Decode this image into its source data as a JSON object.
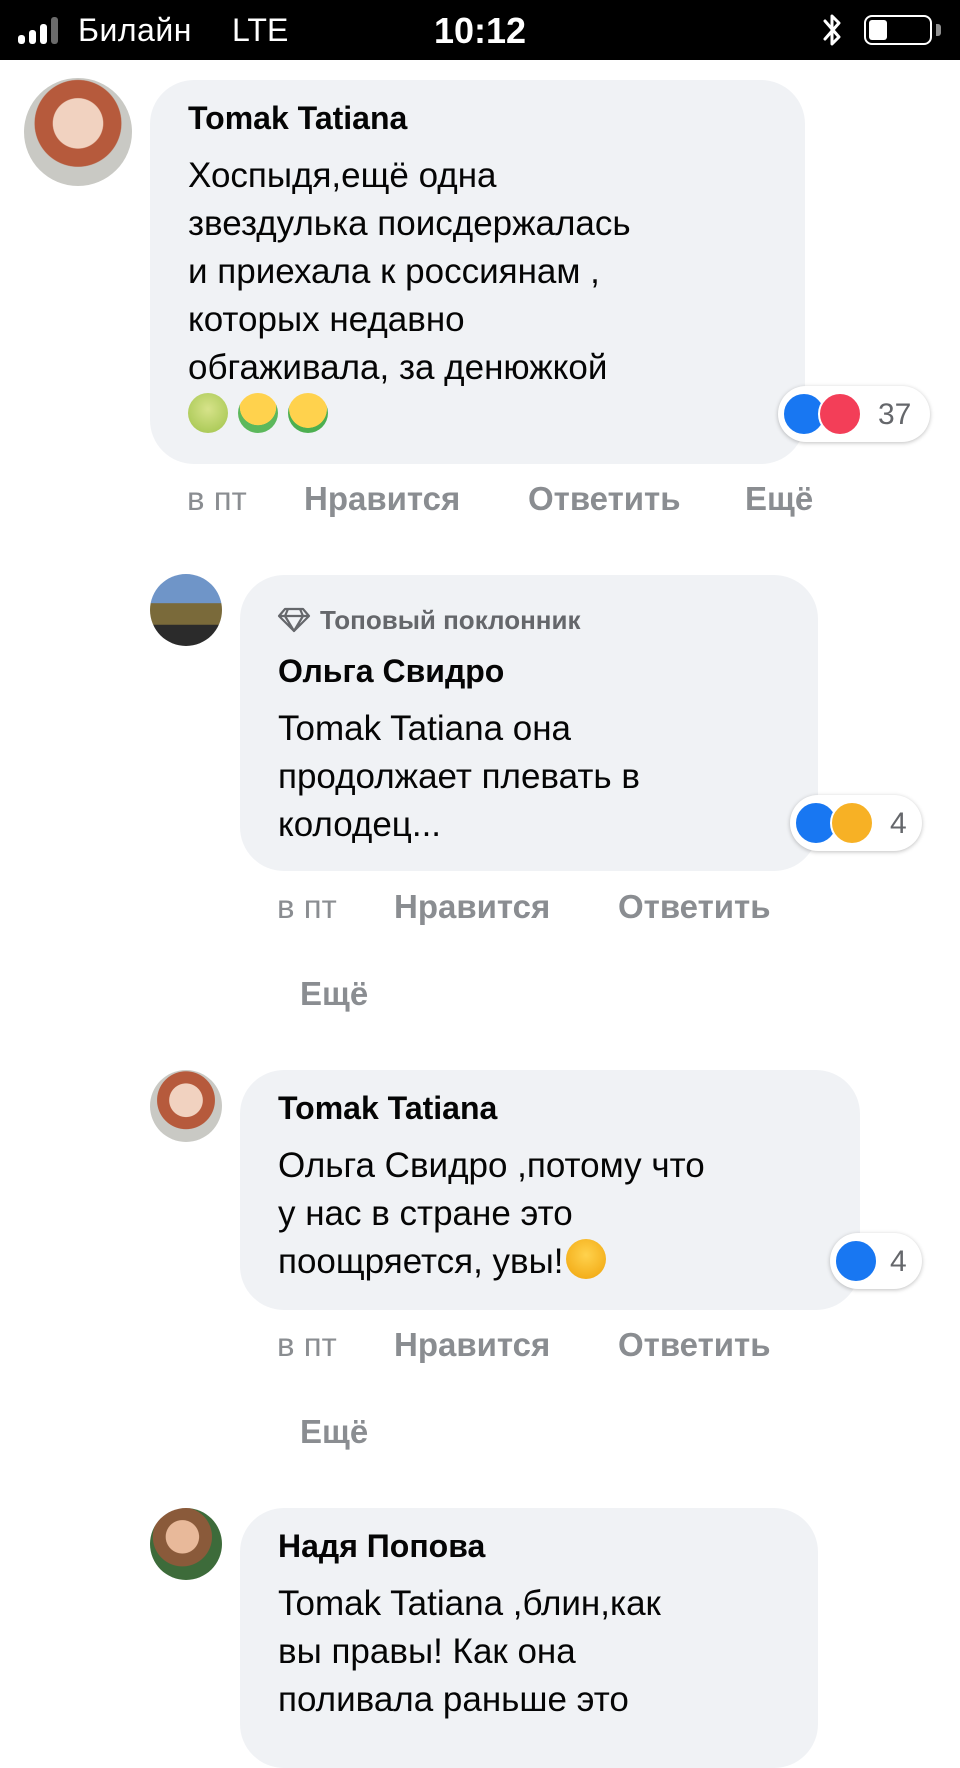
{
  "status_bar": {
    "carrier": "Билайн",
    "network": "LTE",
    "time": "10:12"
  },
  "comments": [
    {
      "author": "Tomak Tatiana",
      "lines": [
        "Хоспыдя,ещё одна",
        "звездулька поисдержалась",
        "и приехала к россиянам ,",
        "которых недавно",
        "обгаживала, за денюжкой"
      ],
      "emojis": [
        "nauseated-face-emoji",
        "vomiting-face-emoji",
        "money-mouth-face-emoji"
      ],
      "reaction_count": "37",
      "reaction_icons": [
        "like-reaction-icon",
        "love-reaction-icon"
      ],
      "time": "в пт",
      "like_label": "Нравится",
      "reply_label": "Ответить",
      "more_label": "Ещё"
    },
    {
      "badge": "Топовый поклонник",
      "author": "Ольга Свидро",
      "lines": [
        "Tomak Tatiana она",
        "продолжает плевать в",
        "колодец..."
      ],
      "reaction_count": "4",
      "reaction_icons": [
        "like-reaction-icon",
        "haha-reaction-icon"
      ],
      "time": "в пт",
      "like_label": "Нравится",
      "reply_label": "Ответить",
      "more_label": "Ещё"
    },
    {
      "author": "Tomak Tatiana",
      "lines": [
        "Ольга Свидро ,потому что",
        "у нас в стране это",
        "поощряется, увы!"
      ],
      "emojis": [
        "frowning-face-emoji"
      ],
      "reaction_count": "4",
      "reaction_icons": [
        "like-reaction-icon"
      ],
      "time": "в пт",
      "like_label": "Нравится",
      "reply_label": "Ответить",
      "more_label": "Ещё"
    },
    {
      "author": "Надя Попова",
      "lines": [
        "Tomak Tatiana ,блин,как",
        "вы правы! Как она",
        "поливала раньше это"
      ]
    }
  ],
  "colors": {
    "bubble": "#f0f2f5",
    "action_text": "#8a8d91",
    "like_blue": "#1877f2",
    "love_red": "#f33e58",
    "haha_yellow": "#f7b125"
  }
}
